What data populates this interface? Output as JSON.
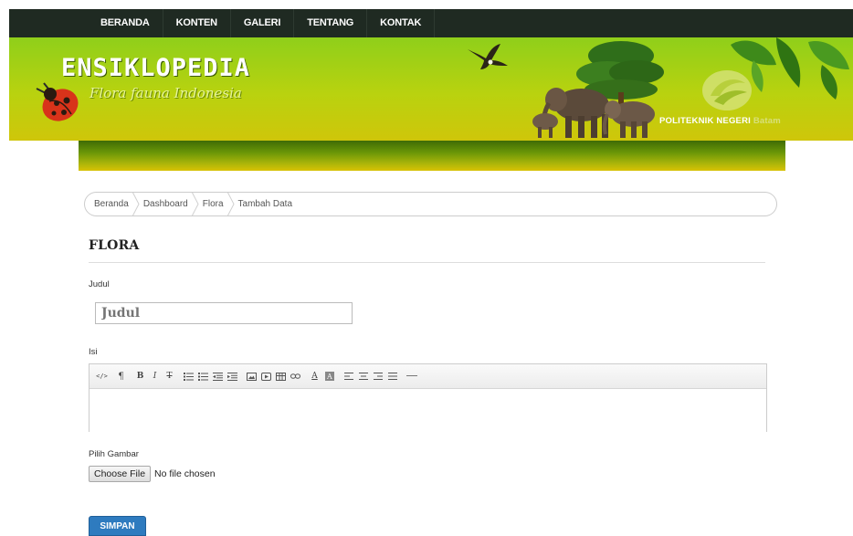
{
  "nav": {
    "items": [
      {
        "label": "BERANDA"
      },
      {
        "label": "KONTEN"
      },
      {
        "label": "GALERI"
      },
      {
        "label": "TENTANG"
      },
      {
        "label": "KONTAK"
      }
    ]
  },
  "banner": {
    "logo_title": "ENSIKLOPEDIA",
    "logo_subtitle": "Flora fauna Indonesia",
    "institution_bright": "POLITEKNIK NEGERI",
    "institution_dim": "Batam",
    "colors": {
      "banner_top": "#8fcf1a",
      "banner_bottom": "#cfc60a",
      "nav_bg": "#1f2a22"
    }
  },
  "breadcrumb": {
    "items": [
      {
        "label": "Beranda"
      },
      {
        "label": "Dashboard"
      },
      {
        "label": "Flora"
      },
      {
        "label": "Tambah Data"
      }
    ]
  },
  "page": {
    "title": "FLORA"
  },
  "form": {
    "judul_label": "Judul",
    "judul_placeholder": "Judul",
    "isi_label": "Isi",
    "gambar_label": "Pilih Gambar",
    "file_button": "Choose File",
    "file_status": "No file chosen",
    "submit_label": "SIMPAN",
    "submit_color": "#2e7bbf"
  },
  "editor": {
    "toolbar": [
      "html-icon",
      "paragraph-icon",
      "bold-icon",
      "italic-icon",
      "strikethrough-icon",
      "unordered-list-icon",
      "ordered-list-icon",
      "outdent-icon",
      "indent-icon",
      "image-icon",
      "video-icon",
      "table-icon",
      "link-icon",
      "font-color-icon",
      "background-color-icon",
      "align-left-icon",
      "align-center-icon",
      "align-right-icon",
      "align-justify-icon",
      "horizontal-rule-icon"
    ]
  }
}
